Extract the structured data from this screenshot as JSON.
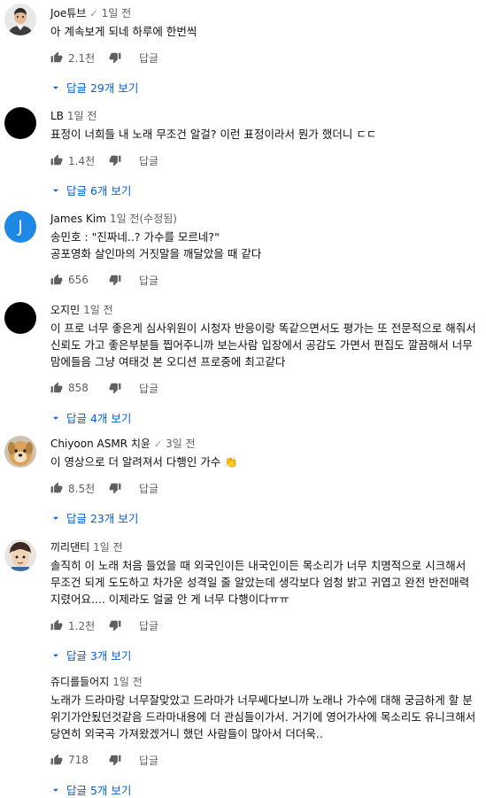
{
  "comments": [
    {
      "author": "Joe튜브",
      "verified": true,
      "time": "1일 전",
      "edited": "",
      "text": "아 계속보게 되네 하루에 한번씩",
      "likes": "2.1천",
      "reply_label": "답글",
      "replies_label": "답글 29개 보기",
      "avatar": {
        "kind": "photo-person"
      }
    },
    {
      "author": "LB",
      "verified": false,
      "time": "1일 전",
      "edited": "",
      "text": "표정이 너희들 내 노래 무조건 알걸? 이런 표정이라서 뭔가 했더니 ㄷㄷ",
      "likes": "1.4천",
      "reply_label": "답글",
      "replies_label": "답글 6개 보기",
      "avatar": {
        "kind": "black"
      }
    },
    {
      "author": "James Kim",
      "verified": false,
      "time": "1일 전(수정됨)",
      "edited": "",
      "text": "송민호 : \"진짜네..? 가수를 모르네?\"\n공포영화 살인마의 거짓말을 깨달았을 때 같다",
      "likes": "656",
      "reply_label": "답글",
      "replies_label": "",
      "avatar": {
        "kind": "letter",
        "letter": "J",
        "color": "#1e88e5"
      }
    },
    {
      "author": "오지민",
      "verified": false,
      "time": "1일 전",
      "edited": "",
      "text": "이 프로 너무 좋은게 심사위원이 시청자 반응이랑 똑같으면서도 평가는 또 전문적으로 해줘서 신뢰도 가고 좋은부분들 찝어주니까 보는사람 입장에서 공감도 가면서 편집도 깔끔해서 너무 맘에들음 그냥 여태것 본 오디션 프로중에 최고같다",
      "likes": "858",
      "reply_label": "답글",
      "replies_label": "답글 4개 보기",
      "avatar": {
        "kind": "black"
      }
    },
    {
      "author": "Chiyoon ASMR 치윤",
      "verified": true,
      "time": "3일 전",
      "edited": "",
      "text": "이 영상으로 더 알려져서 다행인 가수 👏",
      "likes": "8.5천",
      "reply_label": "답글",
      "replies_label": "답글 23개 보기",
      "avatar": {
        "kind": "photo-dog"
      }
    },
    {
      "author": "끼리댄티",
      "verified": false,
      "time": "1일 전",
      "edited": "",
      "text": "솔직히 이 노래 처음 들었을 때 외국인이든 내국인이든 목소리가 너무 치명적으로 시크해서 무조건 되게 도도하고 차가운 성격일 줄 알았는데 생각보다 엄청 밝고 귀엽고 완전 반전매력 지렸어요.... 이제라도 얼굴 안 게 너무 다행이다ㅠㅠ",
      "likes": "1.2천",
      "reply_label": "답글",
      "replies_label": "답글 3개 보기",
      "avatar": {
        "kind": "photo-cartoon"
      }
    },
    {
      "author": "쥬디를들어지",
      "verified": false,
      "time": "1일 전",
      "edited": "",
      "text": "노래가 드라마랑 너무잘맞았고 드라마가 너무쎄다보니까 노래나 가수에 대해 궁금하게 할 분위기가안됬던것같음 드라마내용에 더 관심들이가서. 거기에 영어가사에 목소리도 유니크해서 당연히 외국곡 가져왔겠거니 했던 사람들이 많아서 더더욱..",
      "likes": "718",
      "reply_label": "답글",
      "replies_label": "답글 5개 보기",
      "avatar": {
        "kind": "default-green",
        "color": "#8bc34a"
      }
    }
  ]
}
